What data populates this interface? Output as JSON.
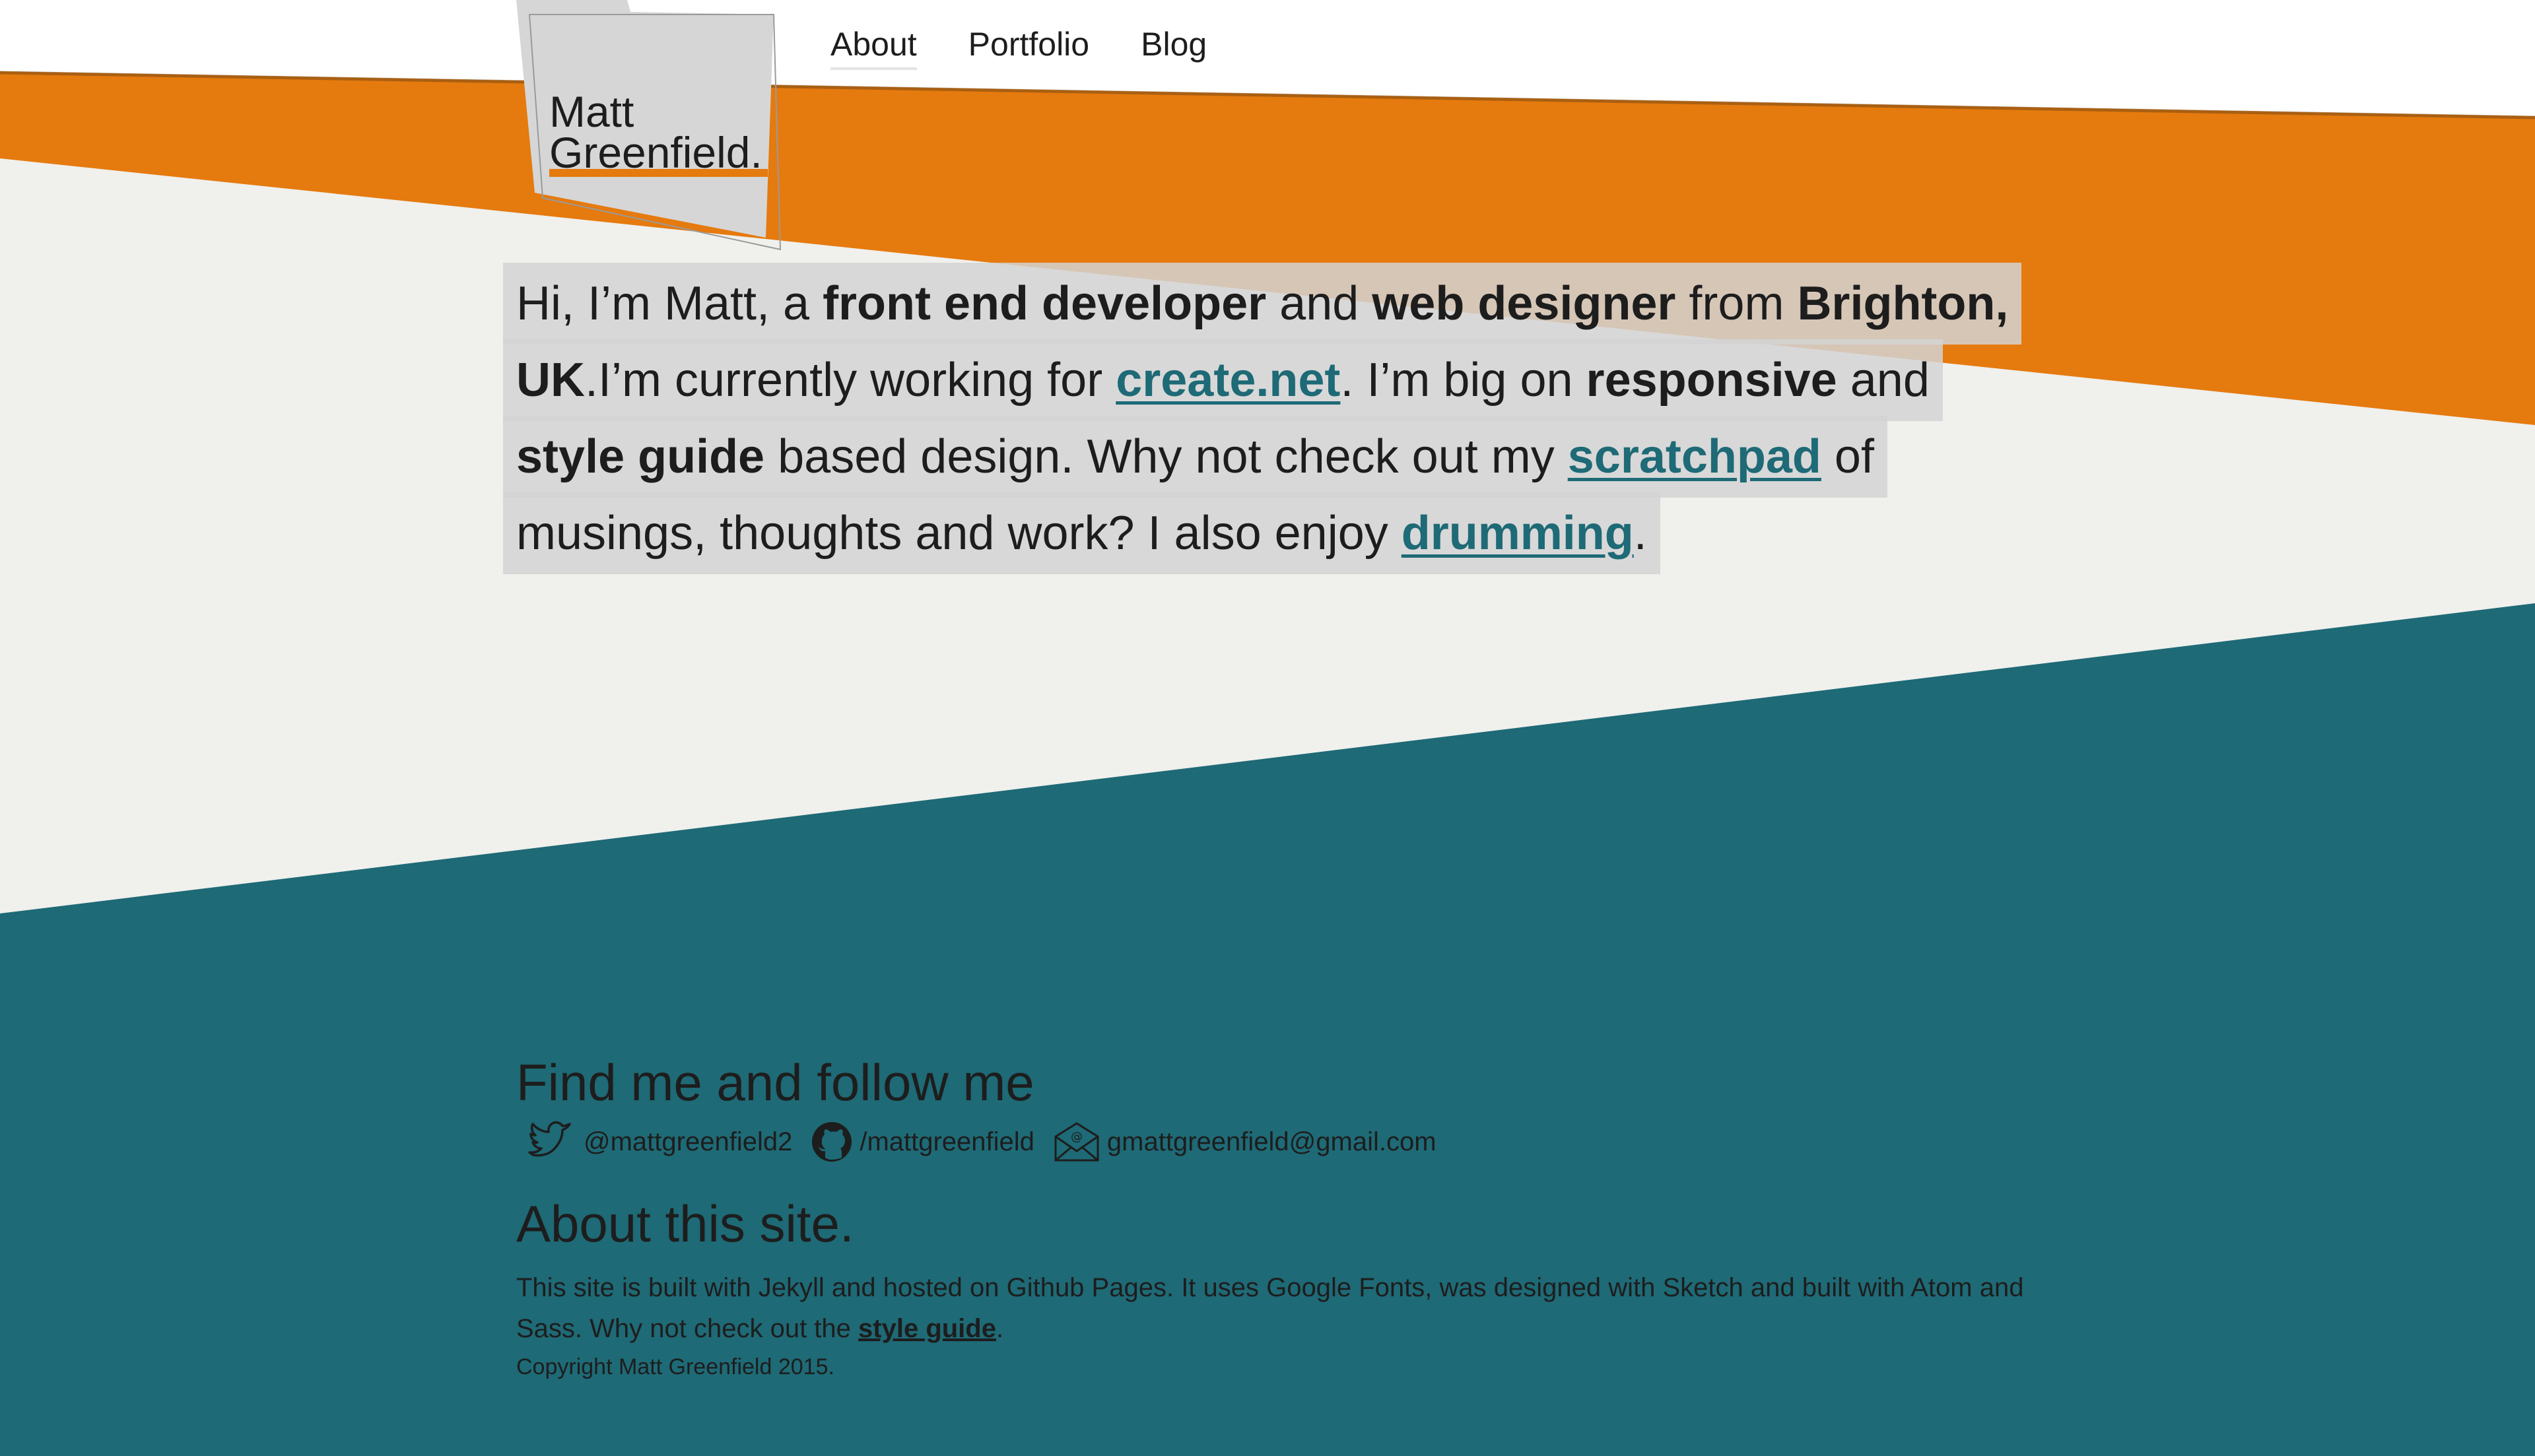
{
  "colors": {
    "orange": "#e57a0e",
    "teal": "#1e6a76",
    "light": "#f0f0ed",
    "text": "#1d1d1d"
  },
  "logo": {
    "line1": "Matt",
    "line2": "Greenfield."
  },
  "nav": {
    "items": [
      "About",
      "Portfolio",
      "Blog"
    ]
  },
  "intro": {
    "t1": "Hi, I’m Matt, a ",
    "b1": "front end developer",
    "t2": " and ",
    "b2": "web designer",
    "t3": " from ",
    "b3": "Brighton, UK",
    "t4": ".I’m currently working for ",
    "link1": "create.net",
    "t5": ". I’m big on ",
    "b4": "responsive",
    "t6": " and ",
    "b5": "style guide",
    "t7": " based design. Why not check out my ",
    "link2": "scratchpad",
    "t8": " of musings, thoughts and work? I also enjoy ",
    "link3": "drumming",
    "t9": "."
  },
  "footer": {
    "follow_heading": "Find me and follow me",
    "social": [
      {
        "icon": "twitter-icon",
        "label": "@mattgreenfield2"
      },
      {
        "icon": "github-icon",
        "label": "/mattgreenfield"
      },
      {
        "icon": "email-icon",
        "label": "gmattgreenfield@gmail.com"
      }
    ],
    "about_heading": "About this site.",
    "about_text": "This site is built with Jekyll and hosted on Github Pages. It uses Google Fonts, was designed with Sketch and built with Atom and Sass. Why not check out the ",
    "about_link": "style guide",
    "about_end": ".",
    "copyright": "Copyright Matt Greenfield 2015."
  }
}
